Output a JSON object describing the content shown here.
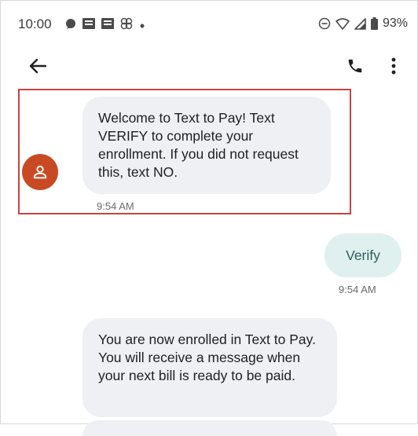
{
  "status_bar": {
    "time": "10:00",
    "battery_text": "93%",
    "icons_left": [
      "chat-icon",
      "notification-icon",
      "notification-icon",
      "pinwheel-icon",
      "dot-icon"
    ],
    "icons_right": [
      "do-not-disturb-icon",
      "wifi-icon",
      "signal-icon",
      "battery-icon"
    ]
  },
  "app_bar": {
    "back_icon": "arrow-left-icon",
    "call_icon": "phone-icon",
    "more_icon": "more-vertical-icon"
  },
  "conversation": {
    "messages": [
      {
        "direction": "incoming",
        "text": "Welcome to Text to Pay! Text VERIFY to complete your enrollment. If you did not request this, text NO.",
        "time": "9:54 AM",
        "highlighted": true
      },
      {
        "direction": "outgoing",
        "text": "Verify",
        "time": "9:54 AM"
      },
      {
        "direction": "incoming",
        "text": "You are now enrolled in Text to Pay. You will receive a message when your next bill is ready to be paid."
      }
    ]
  },
  "colors": {
    "highlight_border": "#c9433f",
    "avatar": "#c84a23",
    "incoming_bubble": "#eef0f4",
    "outgoing_bubble": "#dff0ef",
    "outgoing_text": "#2e5f5d"
  }
}
